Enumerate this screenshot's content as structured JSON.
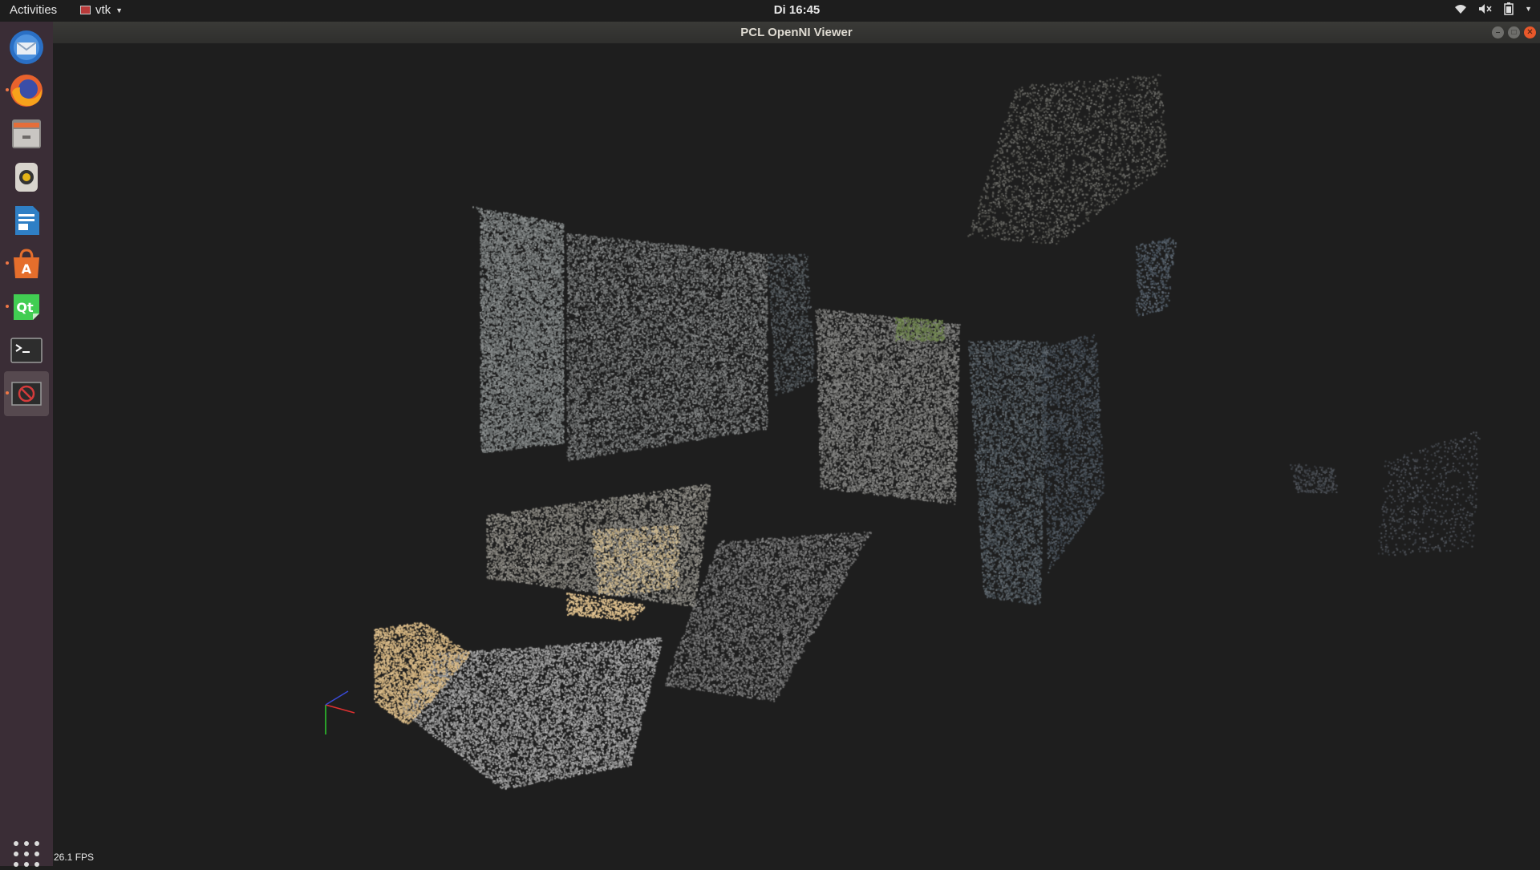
{
  "topbar": {
    "activities": "Activities",
    "app_menu": "vtk",
    "clock": "Di 16:45"
  },
  "window": {
    "title": "PCL OpenNI Viewer"
  },
  "viewer": {
    "fps": "26.1 FPS"
  },
  "dock": {
    "items": [
      {
        "name": "thunderbird",
        "icon": "mail-icon",
        "running": false
      },
      {
        "name": "firefox",
        "icon": "firefox-icon",
        "running": true
      },
      {
        "name": "files",
        "icon": "files-icon",
        "running": false
      },
      {
        "name": "rhythmbox",
        "icon": "speaker-icon",
        "running": false
      },
      {
        "name": "writer",
        "icon": "document-icon",
        "running": false
      },
      {
        "name": "software",
        "icon": "shopping-bag-icon",
        "running": true
      },
      {
        "name": "qt-creator",
        "icon": "qt-icon",
        "running": true
      },
      {
        "name": "terminal",
        "icon": "terminal-icon",
        "running": false
      },
      {
        "name": "vtk-viewer",
        "icon": "stop-icon",
        "running": true
      }
    ]
  },
  "colors": {
    "dock_bg": "#3a2d36",
    "viewer_bg": "#1e1e1e",
    "accent": "#f07746"
  }
}
